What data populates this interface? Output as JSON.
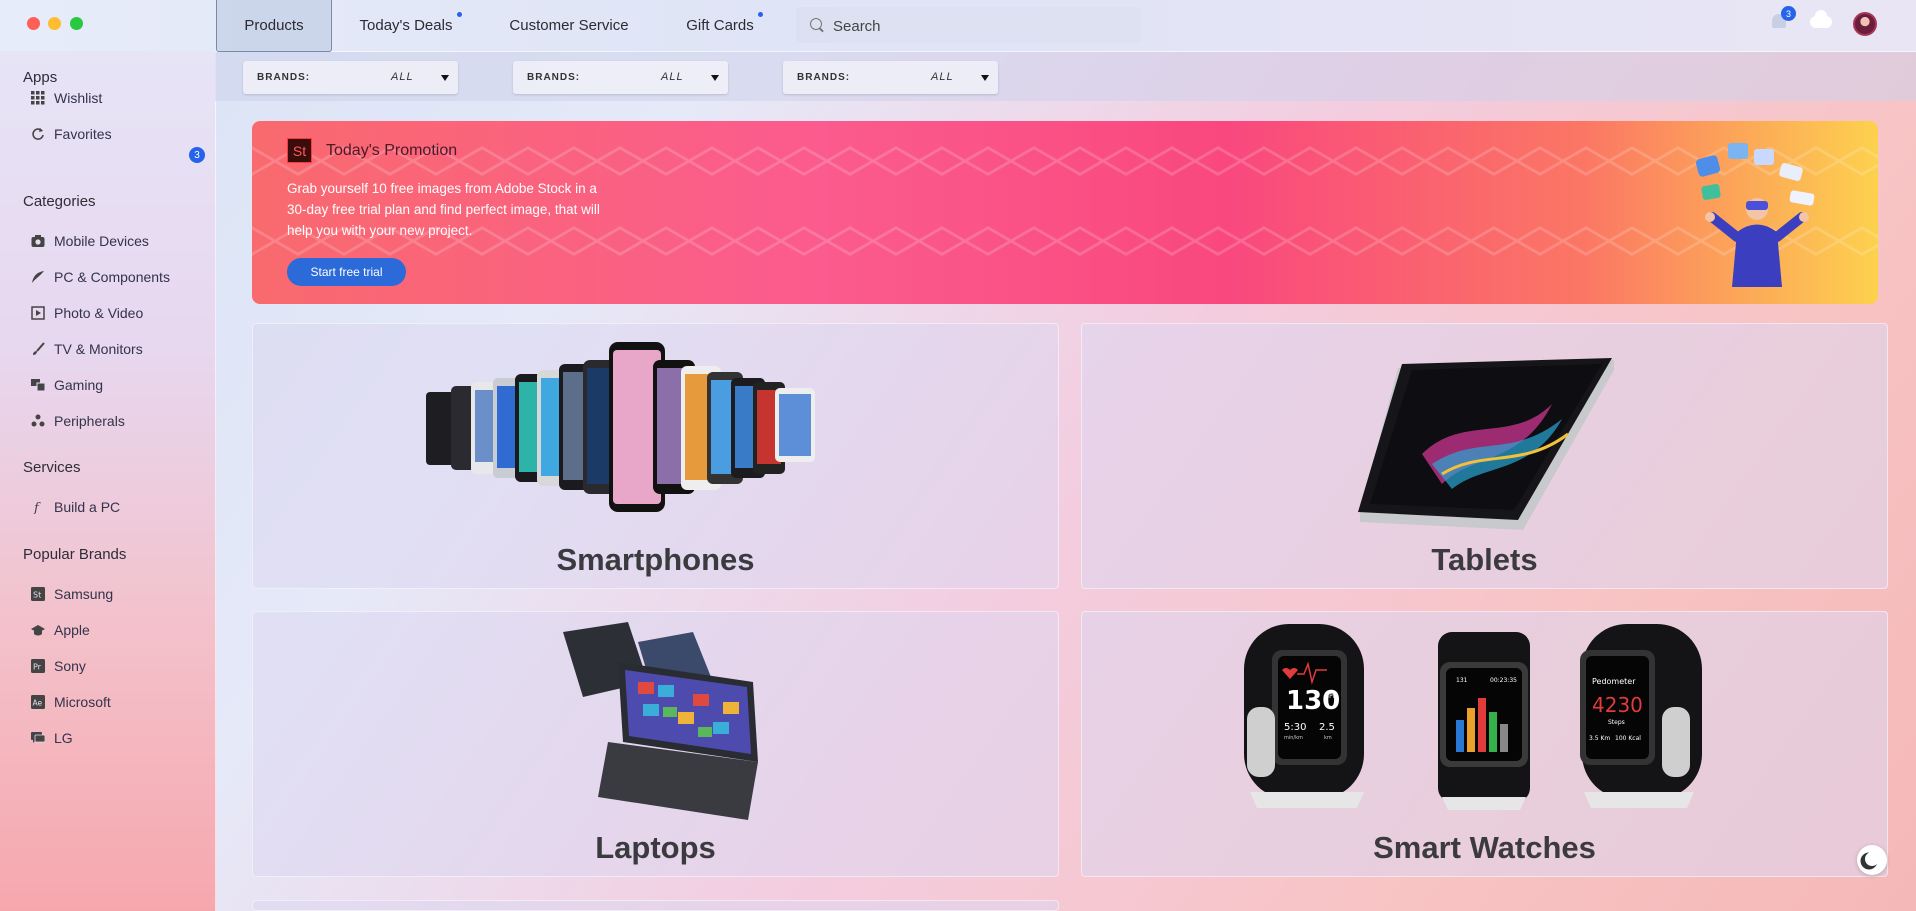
{
  "nav": {
    "tabs": [
      {
        "label": "Products"
      },
      {
        "label": "Today's Deals"
      },
      {
        "label": "Customer Service"
      },
      {
        "label": "Gift Cards"
      }
    ],
    "search_placeholder": "Search",
    "notifications_count": "3"
  },
  "sidebar": {
    "apps_title": "Apps",
    "apps": [
      {
        "label": "Wishlist",
        "icon": "grid-icon"
      },
      {
        "label": "Favorites",
        "icon": "refresh-icon",
        "badge": "3"
      }
    ],
    "categories_title": "Categories",
    "categories": [
      {
        "label": "Mobile Devices",
        "icon": "camera-icon"
      },
      {
        "label": "PC & Components",
        "icon": "feather-icon"
      },
      {
        "label": "Photo & Video",
        "icon": "film-icon"
      },
      {
        "label": "TV & Monitors",
        "icon": "brush-icon"
      },
      {
        "label": "Gaming",
        "icon": "windows-icon"
      },
      {
        "label": "Peripherals",
        "icon": "cubes-icon"
      }
    ],
    "services_title": "Services",
    "services": [
      {
        "label": "Build a PC",
        "icon": "function-icon"
      }
    ],
    "brands_title": "Popular Brands",
    "brands": [
      {
        "label": "Samsung",
        "icon": "st-icon"
      },
      {
        "label": "Apple",
        "icon": "graduation-cap-icon"
      },
      {
        "label": "Sony",
        "icon": "pr-icon"
      },
      {
        "label": "Microsoft",
        "icon": "ae-icon"
      },
      {
        "label": "LG",
        "icon": "chat-icon"
      }
    ]
  },
  "filters": [
    {
      "label": "BRANDS:",
      "value": "ALL"
    },
    {
      "label": "BRANDS:",
      "value": "ALL"
    },
    {
      "label": "BRANDS:",
      "value": "ALL"
    }
  ],
  "promo": {
    "logo": "St",
    "title": "Today's Promotion",
    "text": "Grab yourself 10 free images from Adobe Stock in a 30-day free trial plan and find perfect image, that will help you with your new project.",
    "button": "Start free trial"
  },
  "categories_grid": [
    {
      "title": "Smartphones"
    },
    {
      "title": "Tablets"
    },
    {
      "title": "Laptops"
    },
    {
      "title": "Smart Watches"
    }
  ],
  "watch_screens": {
    "bpm": "130",
    "bpm_unit": "BPM",
    "time": "5:30",
    "time_unit": "min/km",
    "distance": "2.5",
    "distance_unit": "km",
    "mid_a": "131",
    "mid_b": "00:23:35",
    "steps_label": "Pedometer",
    "steps": "4230",
    "steps_unit": "Steps",
    "km": "3.5 Km",
    "kcal": "100 Kcal"
  },
  "colors": {
    "accent": "#2563eb",
    "promo_start": "#f96a6e",
    "promo_end": "#fdd14e"
  }
}
